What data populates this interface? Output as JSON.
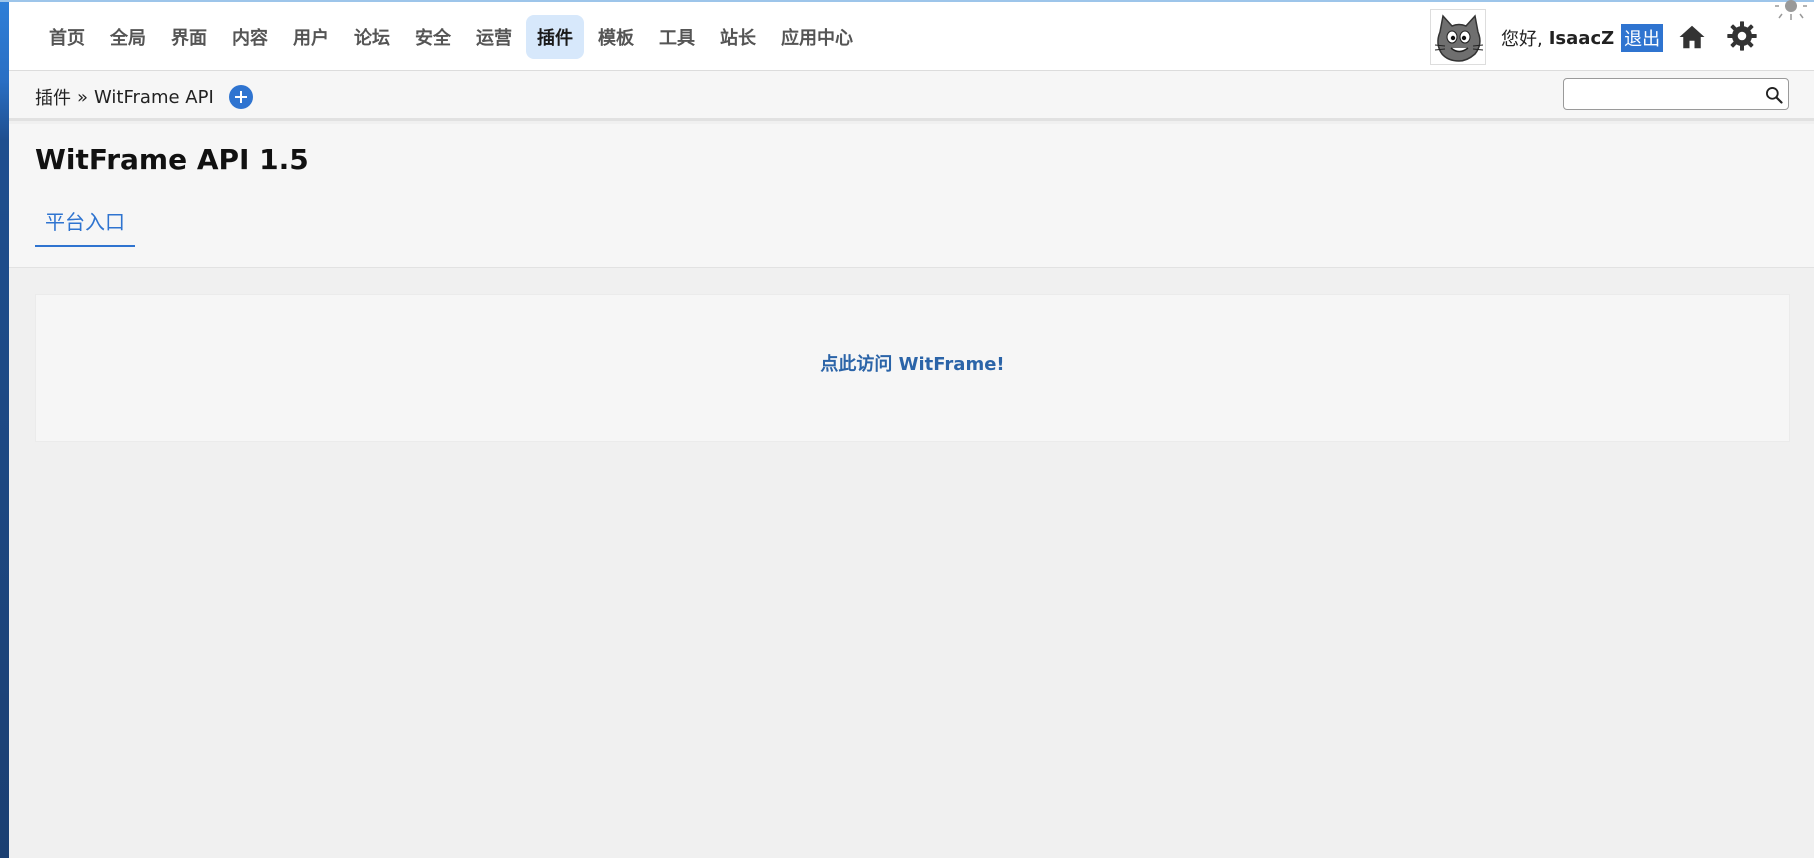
{
  "nav": {
    "items": [
      {
        "label": "首页"
      },
      {
        "label": "全局"
      },
      {
        "label": "界面"
      },
      {
        "label": "内容"
      },
      {
        "label": "用户"
      },
      {
        "label": "论坛"
      },
      {
        "label": "安全"
      },
      {
        "label": "运营"
      },
      {
        "label": "插件",
        "active": true
      },
      {
        "label": "模板"
      },
      {
        "label": "工具"
      },
      {
        "label": "站长"
      },
      {
        "label": "应用中心"
      }
    ]
  },
  "user": {
    "greeting": "您好,",
    "name": "IsaacZ",
    "logout_label": "退出"
  },
  "icons": {
    "avatar": "cat-avatar",
    "home": "home-icon",
    "settings": "gear-icon",
    "theme_light": "sun-icon",
    "theme_dark": "moon-icon",
    "search": "search-icon",
    "add": "plus-circle-icon"
  },
  "breadcrumb": {
    "section": "插件",
    "separator": "»",
    "page": "WitFrame API"
  },
  "search": {
    "value": "",
    "placeholder": ""
  },
  "page": {
    "title": "WitFrame API 1.5",
    "tab_label": "平台入口",
    "link_text": "点此访问 WitFrame!"
  },
  "colors": {
    "accent": "#2f74d0",
    "active_nav_bg": "#d7e8fb",
    "link": "#2b64a8"
  }
}
